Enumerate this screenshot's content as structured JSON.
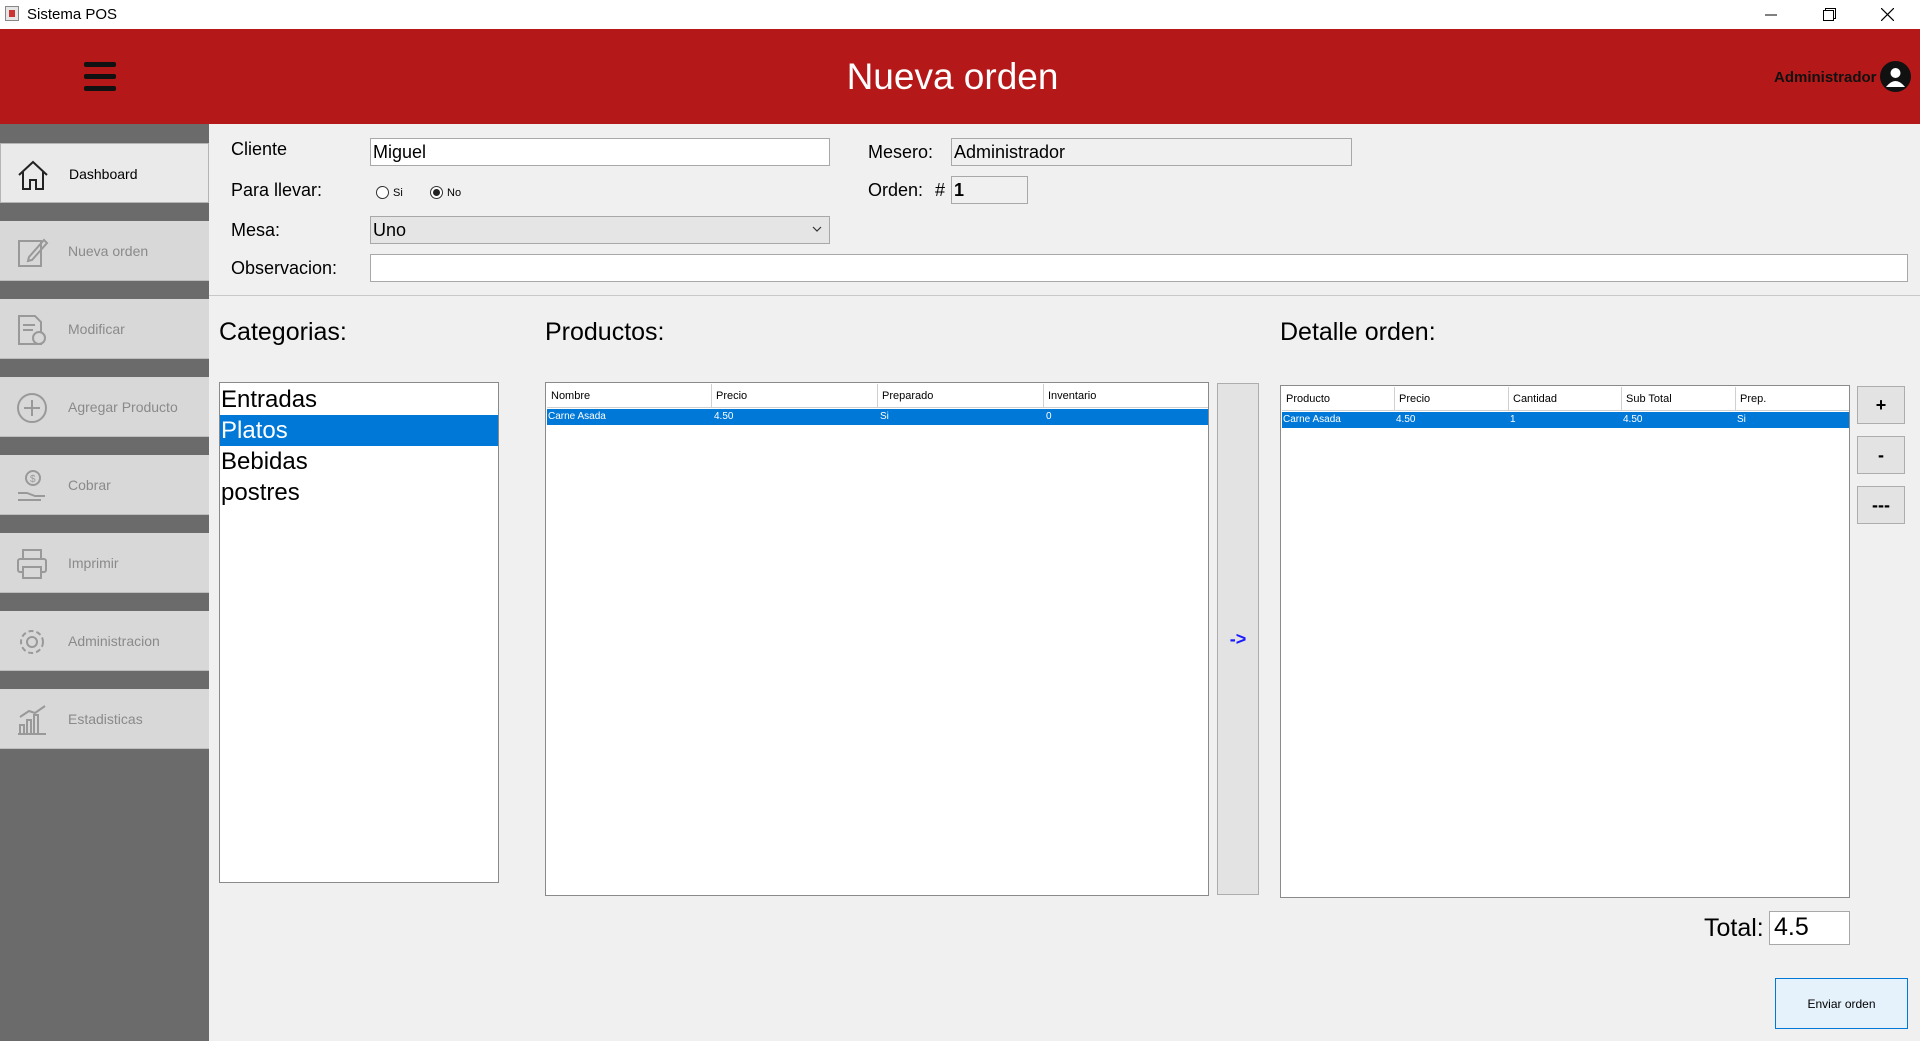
{
  "window": {
    "title": "Sistema POS"
  },
  "header": {
    "title": "Nueva orden",
    "user": "Administrador"
  },
  "sidebar": {
    "items": [
      {
        "label": "Dashboard",
        "icon": "home-icon",
        "active": true
      },
      {
        "label": "Nueva orden",
        "icon": "edit-icon"
      },
      {
        "label": "Modificar",
        "icon": "document-refresh-icon"
      },
      {
        "label": "Agregar Producto",
        "icon": "plus-circle-icon"
      },
      {
        "label": "Cobrar",
        "icon": "money-hand-icon"
      },
      {
        "label": "Imprimir",
        "icon": "printer-icon"
      },
      {
        "label": "Administracion",
        "icon": "gear-icon"
      },
      {
        "label": "Estadisticas",
        "icon": "chart-icon"
      }
    ]
  },
  "form": {
    "cliente_label": "Cliente",
    "cliente_value": "Miguel",
    "llevar_label": "Para llevar:",
    "llevar_si": "Si",
    "llevar_no": "No",
    "llevar_selected": "No",
    "mesa_label": "Mesa:",
    "mesa_value": "Uno",
    "observacion_label": "Observacion:",
    "observacion_value": "",
    "mesero_label": "Mesero:",
    "mesero_value": "Administrador",
    "orden_label": "Orden:",
    "orden_hash": "#",
    "orden_value": "1"
  },
  "categorias": {
    "title": "Categorias:",
    "items": [
      "Entradas",
      "Platos",
      "Bebidas",
      "postres"
    ],
    "selected_index": 1
  },
  "productos": {
    "title": "Productos:",
    "columns": [
      "Nombre",
      "Precio",
      "Preparado",
      "Inventario"
    ],
    "rows": [
      [
        "Carne Asada",
        "4.50",
        "Si",
        "0"
      ]
    ]
  },
  "transfer_button": "->",
  "detalle": {
    "title": "Detalle orden:",
    "columns": [
      "Producto",
      "Precio",
      "Cantidad",
      "Sub Total",
      "Prep."
    ],
    "rows": [
      [
        "Carne Asada",
        "4.50",
        "1",
        "4.50",
        "Si"
      ]
    ]
  },
  "detalle_buttons": {
    "add": "+",
    "remove": "-",
    "clear": "---"
  },
  "total": {
    "label": "Total:",
    "value": "4.5"
  },
  "send_button": "Enviar orden",
  "colors": {
    "header_bg": "#b51818",
    "selection": "#0078d7",
    "sidebar_bg": "#6b6b6b"
  }
}
